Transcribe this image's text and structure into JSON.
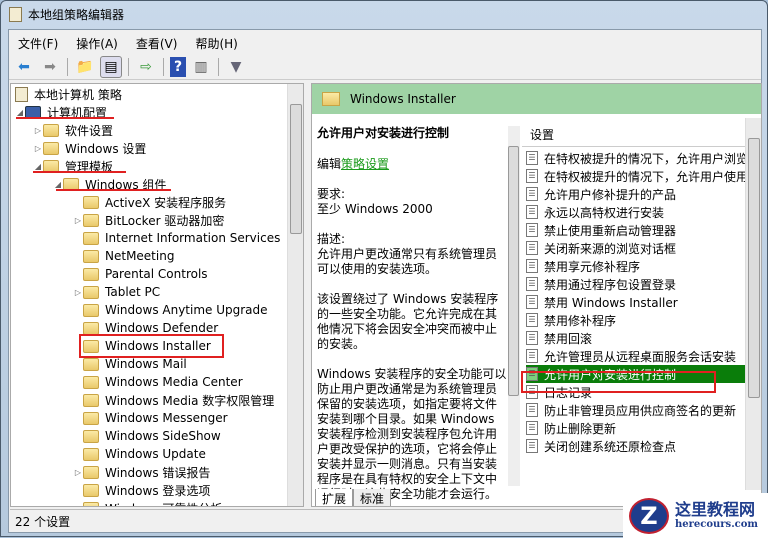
{
  "window": {
    "title": "本地组策略编辑器"
  },
  "menu": [
    "文件(F)",
    "操作(A)",
    "查看(V)",
    "帮助(H)"
  ],
  "tree": {
    "root": "本地计算机 策略",
    "items": [
      {
        "label": "计算机配置",
        "level": 1,
        "expander": "expanded"
      },
      {
        "label": "软件设置",
        "level": 2,
        "expander": "collapsed"
      },
      {
        "label": "Windows 设置",
        "level": 2,
        "expander": "collapsed"
      },
      {
        "label": "管理模板",
        "level": 2,
        "expander": "expanded"
      },
      {
        "label": "Windows 组件",
        "level": 3,
        "expander": "expanded"
      },
      {
        "label": "ActiveX 安装程序服务",
        "level": 4,
        "expander": "none"
      },
      {
        "label": "BitLocker 驱动器加密",
        "level": 4,
        "expander": "collapsed"
      },
      {
        "label": "Internet Information Services",
        "level": 4,
        "expander": "none"
      },
      {
        "label": "NetMeeting",
        "level": 4,
        "expander": "none"
      },
      {
        "label": "Parental Controls",
        "level": 4,
        "expander": "none"
      },
      {
        "label": "Tablet PC",
        "level": 4,
        "expander": "collapsed"
      },
      {
        "label": "Windows Anytime Upgrade",
        "level": 4,
        "expander": "none"
      },
      {
        "label": "Windows Defender",
        "level": 4,
        "expander": "none"
      },
      {
        "label": "Windows Installer",
        "level": 4,
        "expander": "none",
        "selected": true
      },
      {
        "label": "Windows Mail",
        "level": 4,
        "expander": "none"
      },
      {
        "label": "Windows Media Center",
        "level": 4,
        "expander": "none"
      },
      {
        "label": "Windows Media 数字权限管理",
        "level": 4,
        "expander": "none"
      },
      {
        "label": "Windows Messenger",
        "level": 4,
        "expander": "none"
      },
      {
        "label": "Windows SideShow",
        "level": 4,
        "expander": "none"
      },
      {
        "label": "Windows Update",
        "level": 4,
        "expander": "none"
      },
      {
        "label": "Windows 错误报告",
        "level": 4,
        "expander": "collapsed"
      },
      {
        "label": "Windows 登录选项",
        "level": 4,
        "expander": "none"
      },
      {
        "label": "Windows 可靠性分析",
        "level": 4,
        "expander": "none"
      }
    ]
  },
  "right": {
    "header": "Windows Installer",
    "title": "允许用户对安装进行控制",
    "edit_prefix": "编辑",
    "edit_link": "策略设置",
    "req_label": "要求:",
    "req_value": "至少 Windows 2000",
    "desc_label": "描述:",
    "paras": [
      "允许用户更改通常只有系统管理员可以使用的安装选项。",
      "该设置绕过了 Windows 安装程序的一些安全功能。它允许完成在其他情况下将会因安全冲突而被中止的安装。",
      "Windows 安装程序的安全功能可以防止用户更改通常是为系统管理员保留的安装选项，如指定要将文件安装到哪个目录。如果 Windows 安装程序检测到安装程序包允许用户更改受保护的选项，它将会停止安装并显示一则消息。只有当安装程序是在具有特权的安全上下文中运行时，这些安全功能才会运行。"
    ],
    "tabs": [
      "扩展",
      "标准"
    ],
    "list_header": "设置",
    "settings": [
      "在特权被提升的情况下，允许用户浏览",
      "在特权被提升的情况下，允许用户使用",
      "允许用户修补提升的产品",
      "永远以高特权进行安装",
      "禁止使用重新启动管理器",
      "关闭新来源的浏览对话框",
      "禁用享元修补程序",
      "禁用通过程序包设置登录",
      "禁用 Windows Installer",
      "禁用修补程序",
      "禁用回滚",
      "允许管理员从远程桌面服务会话安装",
      "允许用户对安装进行控制",
      "日志记录",
      "防止非管理员应用供应商签名的更新",
      "防止删除更新",
      "关闭创建系统还原检查点"
    ],
    "selected_index": 12
  },
  "status": "22 个设置",
  "watermark": {
    "title": "这里教程网",
    "url": "herecours.com"
  },
  "colors": {
    "selection": "#0a7d0a",
    "header": "#9fd3a5",
    "annotation": "#e02020"
  }
}
